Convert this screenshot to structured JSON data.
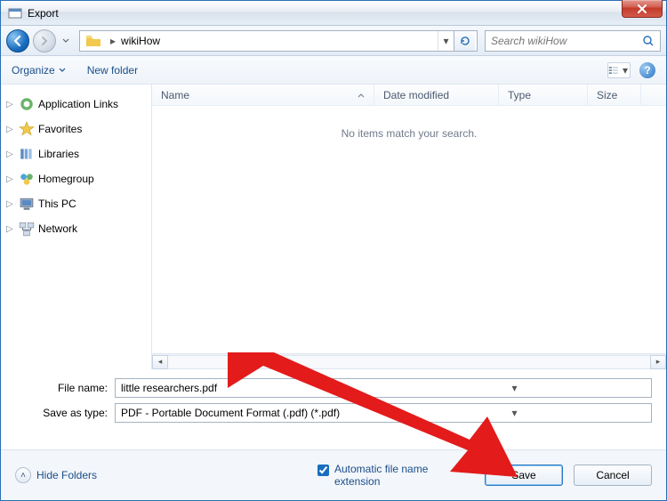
{
  "titlebar": {
    "title": "Export"
  },
  "nav": {
    "location": "wikiHow",
    "search_placeholder": "Search wikiHow"
  },
  "toolbar": {
    "organize": "Organize",
    "newfolder": "New folder"
  },
  "columns": {
    "name": "Name",
    "date": "Date modified",
    "type": "Type",
    "size": "Size"
  },
  "content": {
    "empty": "No items match your search."
  },
  "sidebar": {
    "items": [
      {
        "label": "Application Links"
      },
      {
        "label": "Favorites"
      },
      {
        "label": "Libraries"
      },
      {
        "label": "Homegroup"
      },
      {
        "label": "This PC"
      },
      {
        "label": "Network"
      }
    ]
  },
  "form": {
    "filename_label": "File name:",
    "filename_value": "little researchers.pdf",
    "saveas_label": "Save as type:",
    "saveas_value": "PDF - Portable Document Format (.pdf) (*.pdf)"
  },
  "bottom": {
    "hide_folders": "Hide Folders",
    "auto_ext": "Automatic file name extension",
    "save": "Save",
    "cancel": "Cancel"
  }
}
